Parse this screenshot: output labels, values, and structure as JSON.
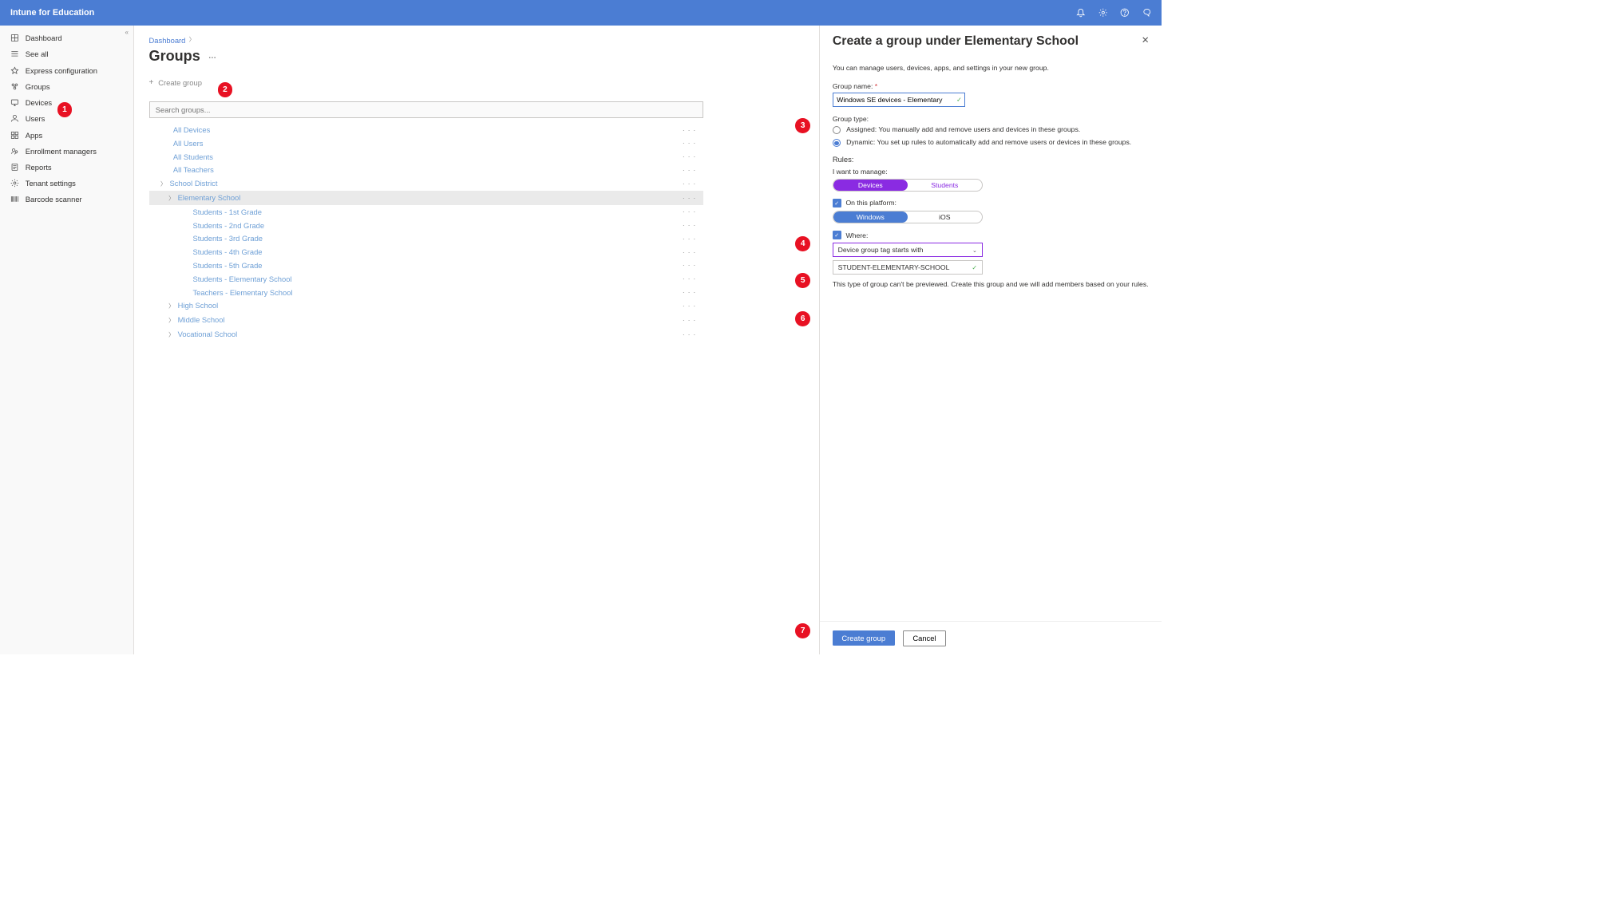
{
  "brand": "Intune for Education",
  "sidebar": {
    "items": [
      {
        "label": "Dashboard"
      },
      {
        "label": "See all"
      },
      {
        "label": "Express configuration"
      },
      {
        "label": "Groups"
      },
      {
        "label": "Devices"
      },
      {
        "label": "Users"
      },
      {
        "label": "Apps"
      },
      {
        "label": "Enrollment managers"
      },
      {
        "label": "Reports"
      },
      {
        "label": "Tenant settings"
      },
      {
        "label": "Barcode scanner"
      }
    ]
  },
  "breadcrumb": {
    "root": "Dashboard"
  },
  "page": {
    "title": "Groups"
  },
  "toolbar": {
    "create_group": "Create group",
    "search_placeholder": "Search groups..."
  },
  "tree": {
    "items": [
      {
        "label": "All Devices",
        "indent": 0,
        "expand": false
      },
      {
        "label": "All Users",
        "indent": 0,
        "expand": false
      },
      {
        "label": "All Students",
        "indent": 0,
        "expand": false
      },
      {
        "label": "All Teachers",
        "indent": 0,
        "expand": false
      },
      {
        "label": "School District",
        "indent": 1,
        "expand": true
      },
      {
        "label": "Elementary School",
        "indent": 2,
        "expand": true,
        "selected": true
      },
      {
        "label": "Students - 1st Grade",
        "indent": 3,
        "expand": false
      },
      {
        "label": "Students - 2nd Grade",
        "indent": 3,
        "expand": false
      },
      {
        "label": "Students - 3rd Grade",
        "indent": 3,
        "expand": false
      },
      {
        "label": "Students - 4th Grade",
        "indent": 3,
        "expand": false
      },
      {
        "label": "Students - 5th Grade",
        "indent": 3,
        "expand": false
      },
      {
        "label": "Students - Elementary School",
        "indent": 3,
        "expand": false
      },
      {
        "label": "Teachers - Elementary School",
        "indent": 3,
        "expand": false
      },
      {
        "label": "High School",
        "indent": 2,
        "expand": true
      },
      {
        "label": "Middle School",
        "indent": 2,
        "expand": true
      },
      {
        "label": "Vocational School",
        "indent": 2,
        "expand": true
      }
    ]
  },
  "panel": {
    "title": "Create a group under Elementary School",
    "help": "You can manage users, devices, apps, and settings in your new group.",
    "group_name_label": "Group name:",
    "group_name_value": "Windows SE devices - Elementary",
    "group_type_label": "Group type:",
    "assigned_label": "Assigned: You manually add and remove users and devices in these groups.",
    "dynamic_label": "Dynamic: You set up rules to automatically add and remove users or devices in these groups.",
    "rules_label": "Rules:",
    "manage_label": "I want to manage:",
    "manage_devices": "Devices",
    "manage_students": "Students",
    "platform_label": "On this platform:",
    "platform_windows": "Windows",
    "platform_ios": "iOS",
    "where_label": "Where:",
    "where_select": "Device group tag starts with",
    "where_value": "STUDENT-ELEMENTARY-SCHOOL",
    "note": "This type of group can't be previewed. Create this group and we will add members based on your rules.",
    "create_btn": "Create group",
    "cancel_btn": "Cancel"
  },
  "callouts": {
    "c1": "1",
    "c2": "2",
    "c3": "3",
    "c4": "4",
    "c5": "5",
    "c6": "6",
    "c7": "7"
  }
}
